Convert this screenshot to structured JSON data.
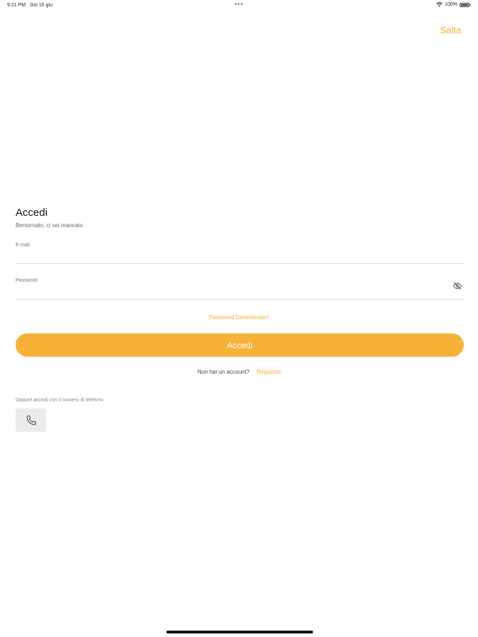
{
  "status_bar": {
    "time": "9:21 PM",
    "date": "Gio 15 giu",
    "dots": "•••",
    "battery_pct": "100%"
  },
  "header": {
    "skip_label": "Salta"
  },
  "login": {
    "title": "Accedi",
    "subtitle": "Bentornato, ci sei mancato",
    "email_label": "E-mail",
    "email_value": "",
    "password_label": "Password",
    "password_value": "",
    "forgot_label": "Password Dimenticata?",
    "submit_label": "Accedi",
    "no_account_text": "Non hai un account?",
    "register_label": "Registrati",
    "phone_alt_text": "Oppure accedi con il numero di telefono"
  },
  "icons": {
    "password_toggle": "eye-slash-icon",
    "phone": "phone-icon",
    "wifi": "wifi-icon",
    "battery": "battery-icon"
  },
  "colors": {
    "accent": "#f6b237",
    "accent_text": "#f6ac2e",
    "divider": "#e0e0e0",
    "phone_btn_bg": "#ececec"
  }
}
